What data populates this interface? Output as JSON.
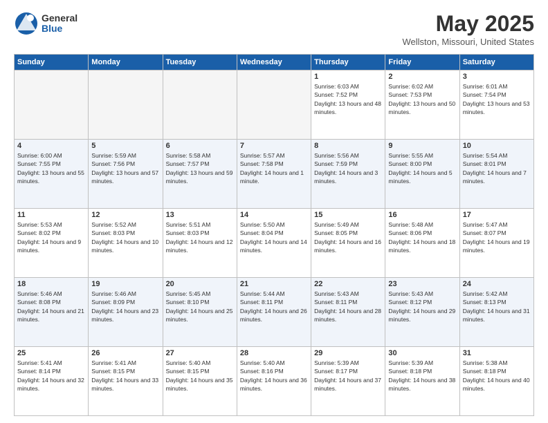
{
  "app": {
    "name_general": "General",
    "name_blue": "Blue"
  },
  "title": {
    "month_year": "May 2025",
    "location": "Wellston, Missouri, United States"
  },
  "weekdays": [
    "Sunday",
    "Monday",
    "Tuesday",
    "Wednesday",
    "Thursday",
    "Friday",
    "Saturday"
  ],
  "weeks": [
    [
      {
        "day": "",
        "empty": true
      },
      {
        "day": "",
        "empty": true
      },
      {
        "day": "",
        "empty": true
      },
      {
        "day": "",
        "empty": true
      },
      {
        "day": "1",
        "sunrise": "6:03 AM",
        "sunset": "7:52 PM",
        "daylight": "13 hours and 48 minutes."
      },
      {
        "day": "2",
        "sunrise": "6:02 AM",
        "sunset": "7:53 PM",
        "daylight": "13 hours and 50 minutes."
      },
      {
        "day": "3",
        "sunrise": "6:01 AM",
        "sunset": "7:54 PM",
        "daylight": "13 hours and 53 minutes."
      }
    ],
    [
      {
        "day": "4",
        "sunrise": "6:00 AM",
        "sunset": "7:55 PM",
        "daylight": "13 hours and 55 minutes."
      },
      {
        "day": "5",
        "sunrise": "5:59 AM",
        "sunset": "7:56 PM",
        "daylight": "13 hours and 57 minutes."
      },
      {
        "day": "6",
        "sunrise": "5:58 AM",
        "sunset": "7:57 PM",
        "daylight": "13 hours and 59 minutes."
      },
      {
        "day": "7",
        "sunrise": "5:57 AM",
        "sunset": "7:58 PM",
        "daylight": "14 hours and 1 minute."
      },
      {
        "day": "8",
        "sunrise": "5:56 AM",
        "sunset": "7:59 PM",
        "daylight": "14 hours and 3 minutes."
      },
      {
        "day": "9",
        "sunrise": "5:55 AM",
        "sunset": "8:00 PM",
        "daylight": "14 hours and 5 minutes."
      },
      {
        "day": "10",
        "sunrise": "5:54 AM",
        "sunset": "8:01 PM",
        "daylight": "14 hours and 7 minutes."
      }
    ],
    [
      {
        "day": "11",
        "sunrise": "5:53 AM",
        "sunset": "8:02 PM",
        "daylight": "14 hours and 9 minutes."
      },
      {
        "day": "12",
        "sunrise": "5:52 AM",
        "sunset": "8:03 PM",
        "daylight": "14 hours and 10 minutes."
      },
      {
        "day": "13",
        "sunrise": "5:51 AM",
        "sunset": "8:03 PM",
        "daylight": "14 hours and 12 minutes."
      },
      {
        "day": "14",
        "sunrise": "5:50 AM",
        "sunset": "8:04 PM",
        "daylight": "14 hours and 14 minutes."
      },
      {
        "day": "15",
        "sunrise": "5:49 AM",
        "sunset": "8:05 PM",
        "daylight": "14 hours and 16 minutes."
      },
      {
        "day": "16",
        "sunrise": "5:48 AM",
        "sunset": "8:06 PM",
        "daylight": "14 hours and 18 minutes."
      },
      {
        "day": "17",
        "sunrise": "5:47 AM",
        "sunset": "8:07 PM",
        "daylight": "14 hours and 19 minutes."
      }
    ],
    [
      {
        "day": "18",
        "sunrise": "5:46 AM",
        "sunset": "8:08 PM",
        "daylight": "14 hours and 21 minutes."
      },
      {
        "day": "19",
        "sunrise": "5:46 AM",
        "sunset": "8:09 PM",
        "daylight": "14 hours and 23 minutes."
      },
      {
        "day": "20",
        "sunrise": "5:45 AM",
        "sunset": "8:10 PM",
        "daylight": "14 hours and 25 minutes."
      },
      {
        "day": "21",
        "sunrise": "5:44 AM",
        "sunset": "8:11 PM",
        "daylight": "14 hours and 26 minutes."
      },
      {
        "day": "22",
        "sunrise": "5:43 AM",
        "sunset": "8:11 PM",
        "daylight": "14 hours and 28 minutes."
      },
      {
        "day": "23",
        "sunrise": "5:43 AM",
        "sunset": "8:12 PM",
        "daylight": "14 hours and 29 minutes."
      },
      {
        "day": "24",
        "sunrise": "5:42 AM",
        "sunset": "8:13 PM",
        "daylight": "14 hours and 31 minutes."
      }
    ],
    [
      {
        "day": "25",
        "sunrise": "5:41 AM",
        "sunset": "8:14 PM",
        "daylight": "14 hours and 32 minutes."
      },
      {
        "day": "26",
        "sunrise": "5:41 AM",
        "sunset": "8:15 PM",
        "daylight": "14 hours and 33 minutes."
      },
      {
        "day": "27",
        "sunrise": "5:40 AM",
        "sunset": "8:15 PM",
        "daylight": "14 hours and 35 minutes."
      },
      {
        "day": "28",
        "sunrise": "5:40 AM",
        "sunset": "8:16 PM",
        "daylight": "14 hours and 36 minutes."
      },
      {
        "day": "29",
        "sunrise": "5:39 AM",
        "sunset": "8:17 PM",
        "daylight": "14 hours and 37 minutes."
      },
      {
        "day": "30",
        "sunrise": "5:39 AM",
        "sunset": "8:18 PM",
        "daylight": "14 hours and 38 minutes."
      },
      {
        "day": "31",
        "sunrise": "5:38 AM",
        "sunset": "8:18 PM",
        "daylight": "14 hours and 40 minutes."
      }
    ]
  ]
}
